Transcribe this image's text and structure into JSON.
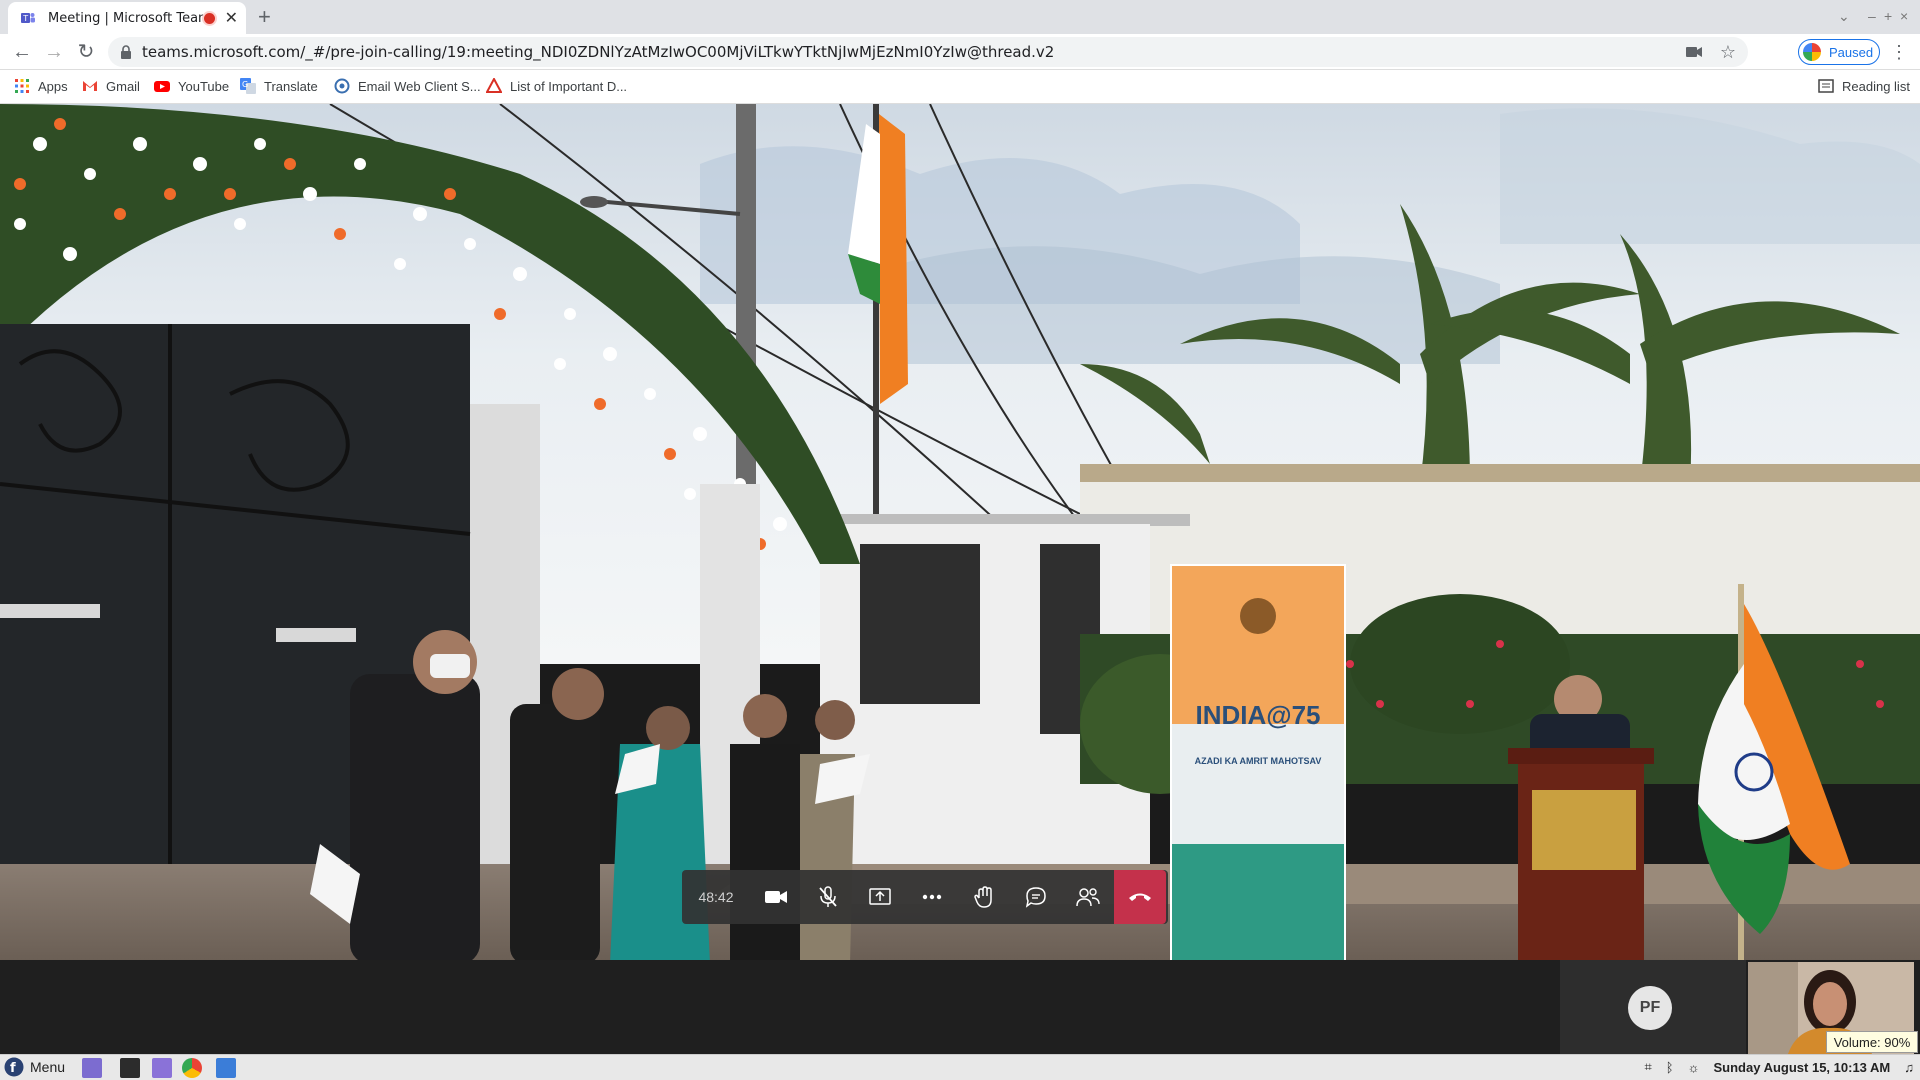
{
  "browser": {
    "tab_title": "Meeting | Microsoft Teams",
    "tab_close": "✕",
    "new_tab": "+",
    "url_host": "teams.microsoft.com",
    "url_path": "/_#/pre-join-calling/19:meeting_NDI0ZDNlYzAtMzIwOC00MjViLTkwYTktNjIwMjEzNmI0YzIw@thread.v2",
    "profile_label": "Paused",
    "bookmarks": [
      {
        "label": "Apps"
      },
      {
        "label": "Gmail"
      },
      {
        "label": "YouTube"
      },
      {
        "label": "Translate"
      },
      {
        "label": "Email Web Client S..."
      },
      {
        "label": "List of Important D..."
      }
    ],
    "reading_list": "Reading list"
  },
  "meeting": {
    "timer": "48:42",
    "participant_initials": "PF",
    "volume_tooltip": "Volume: 90%",
    "banner_text": "INDIA@75",
    "banner_subtext": "AZADI KA AMRIT MAHOTSAV"
  },
  "taskbar": {
    "menu_label": "Menu",
    "datetime": "Sunday August 15, 10:13 AM"
  },
  "colors": {
    "end_call": "#c4314b",
    "accent_blue": "#1a73e8",
    "recording_red": "#d93025"
  }
}
